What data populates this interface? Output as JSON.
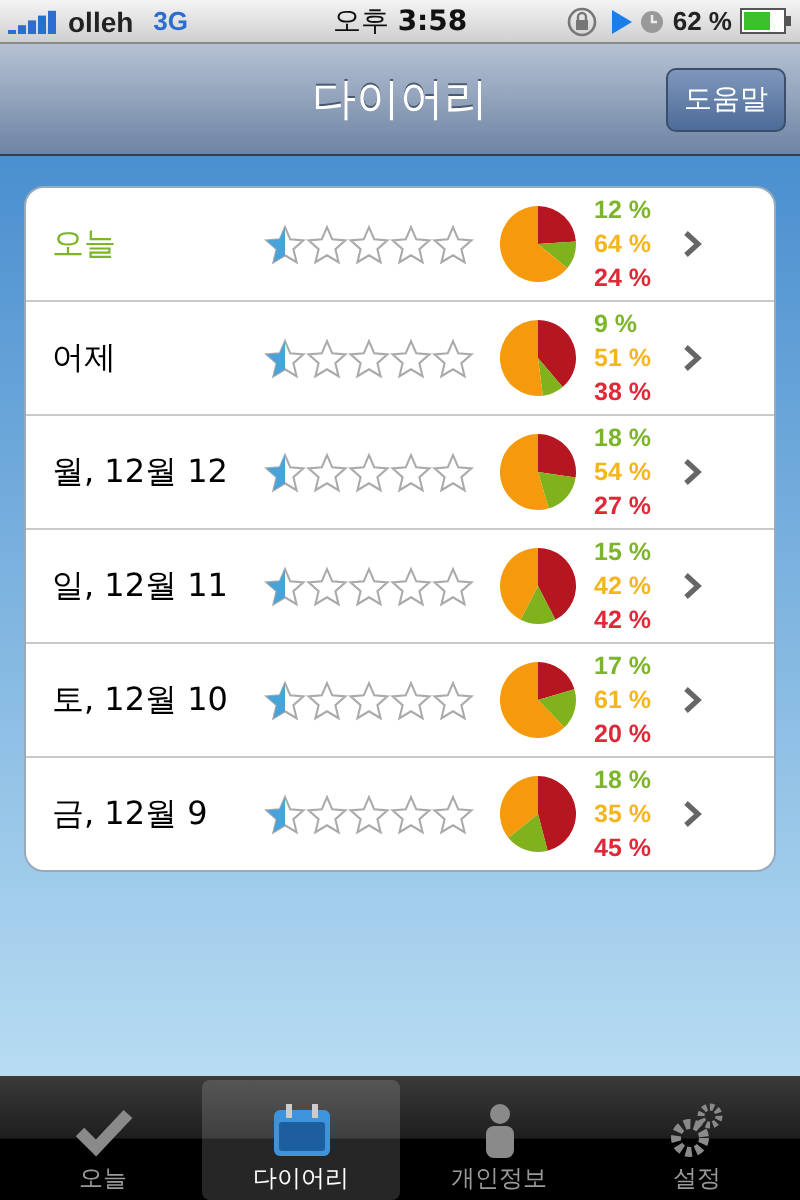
{
  "status_bar": {
    "carrier": "olleh",
    "network": "3G",
    "time": "오후 **3:58**",
    "battery": "62 %"
  },
  "nav_bar": {
    "title": "다이어리",
    "button": "도움말"
  },
  "rows": [
    {
      "label": "오늘",
      "today": true,
      "stars": 0.5,
      "green": "12 %",
      "orange": "64 %",
      "red": "24 %"
    },
    {
      "label": "어제",
      "today": false,
      "stars": 0.5,
      "green": "9 %",
      "orange": "51 %",
      "red": "38 %"
    },
    {
      "label": "월, 12월 12",
      "today": false,
      "stars": 0.5,
      "green": "18 %",
      "orange": "54 %",
      "red": "27 %"
    },
    {
      "label": "일, 12월 11",
      "today": false,
      "stars": 0.5,
      "green": "15 %",
      "orange": "42 %",
      "red": "42 %"
    },
    {
      "label": "토, 12월 10",
      "today": false,
      "stars": 0.5,
      "green": "17 %",
      "orange": "61 %",
      "red": "20 %"
    },
    {
      "label": "금, 12월 9",
      "today": false,
      "stars": 0.5,
      "green": "18 %",
      "orange": "35 %",
      "red": "45 %"
    }
  ],
  "tabs": [
    {
      "label": "오늘",
      "kind": "check",
      "selected": false
    },
    {
      "label": "다이어리",
      "kind": "calendar",
      "selected": true
    },
    {
      "label": "개인정보",
      "kind": "person",
      "selected": false
    },
    {
      "label": "설정",
      "kind": "gears",
      "selected": false
    }
  ]
}
